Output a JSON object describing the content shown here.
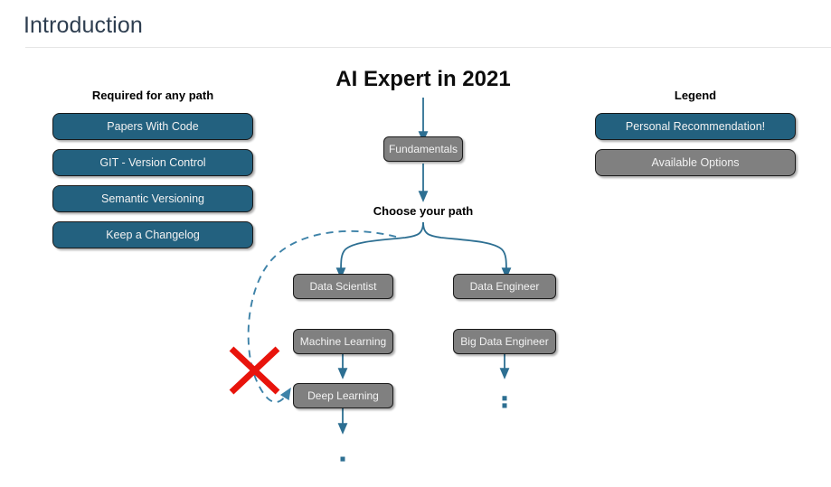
{
  "header": {
    "title": "Introduction"
  },
  "diagram": {
    "title": "AI Expert in 2021",
    "choose_path_label": "Choose your path",
    "root_node": "Fundamentals",
    "left_branch": [
      "Data Scientist",
      "Machine Learning",
      "Deep Learning"
    ],
    "right_branch": [
      "Data Engineer",
      "Big Data Engineer"
    ]
  },
  "required_section": {
    "caption": "Required for any path",
    "items": [
      "Papers With Code",
      "GIT - Version Control",
      "Semantic Versioning",
      "Keep a Changelog"
    ]
  },
  "legend": {
    "caption": "Legend",
    "items": [
      {
        "label": "Personal Recommendation!",
        "style": "blue"
      },
      {
        "label": "Available Options",
        "style": "gray"
      }
    ]
  },
  "colors": {
    "accent_blue": "#23617f",
    "node_gray": "#808080",
    "title_navy": "#2e3e50",
    "cross_red": "#e8140c",
    "edge_blue": "#2d6f92",
    "divider": "#e6e6e6",
    "background": "#ffffff"
  },
  "annotations": {
    "cross_mark": "red-x-cross"
  }
}
